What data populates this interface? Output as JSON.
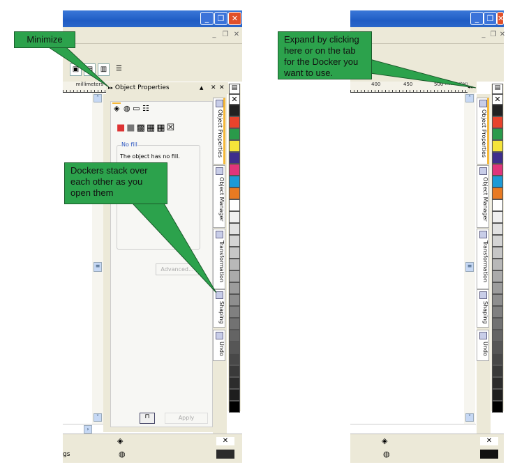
{
  "left_window": {
    "docker": {
      "title": "Object Properties",
      "fill_group": "No fill",
      "fill_text": "The object has no fill.",
      "advanced_button": "Advanced...",
      "apply_button": "Apply"
    },
    "ruler_unit": "millimeters",
    "status_text": "gs",
    "tabs": [
      "Object Properties",
      "Object Manager",
      "Transformation",
      "Shaping",
      "Undo"
    ]
  },
  "right_window": {
    "ruler_labels": [
      "400",
      "450",
      "500",
      "millimeters"
    ],
    "tabs": [
      "Object Properties",
      "Object Manager",
      "Transformation",
      "Shaping",
      "Undo"
    ]
  },
  "callouts": {
    "minimize": "Minimize",
    "stack": "Dockers stack over each other as you open them",
    "expand": "Expand by clicking here or on the tab for the Docker you want to use."
  },
  "palette_colors": [
    "#222222",
    "#e8432c",
    "#2a9a4a",
    "#f5e43a",
    "#3e2e8c",
    "#e0357a",
    "#1d9ad6",
    "#e87a22",
    "#ffffff",
    "#f0f0f0",
    "#e2e2e2",
    "#d4d4d4",
    "#c6c6c6",
    "#b8b8b8",
    "#aaaaaa",
    "#9c9c9c",
    "#8e8e8e",
    "#808080",
    "#727272",
    "#646464",
    "#565656",
    "#484848",
    "#3a3a3a",
    "#2c2c2c",
    "#1e1e1e",
    "#000000"
  ],
  "colors": {
    "callout": "#2ca24c",
    "titlebar": "#1f5cc4"
  }
}
